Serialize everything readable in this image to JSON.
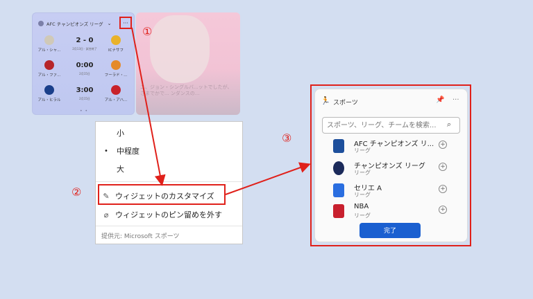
{
  "widget": {
    "title": "AFC チャンピオンズ リーグ",
    "chevron": "chevron-down",
    "more_label": "···",
    "pager": "• •",
    "matches": [
      {
        "home": "アル・シャ...",
        "away": "ICナサフ",
        "score": "2 - 0",
        "sub": "2月13日 · 試合終了",
        "home_color": "#d0c9b8",
        "away_color": "#e9b22a"
      },
      {
        "home": "アル・ファ...",
        "away": "フーラド・...",
        "score": "0:00",
        "sub": "2月15日",
        "home_color": "#b6252a",
        "away_color": "#e58a2a"
      },
      {
        "home": "アル・ヒラル",
        "away": "アル・アハ...",
        "score": "3:00",
        "sub": "2月15日",
        "home_color": "#1a3f8a",
        "away_color": "#c8222a"
      }
    ]
  },
  "news": {
    "text": "ニ、ジョン・シングルバ...ットでしたが、さまでかで... ンダンスの..."
  },
  "annotations": {
    "one": "①",
    "two": "②",
    "three": "③",
    "color": "#e0201a"
  },
  "menu": {
    "items": [
      {
        "label": "小",
        "selected": false
      },
      {
        "label": "中程度",
        "selected": true
      },
      {
        "label": "大",
        "selected": false
      }
    ],
    "customize": "ウィジェットのカスタマイズ",
    "unpin": "ウィジェットのピン留めを外す",
    "provider": "提供元: Microsoft スポーツ",
    "bullet": "•"
  },
  "sports": {
    "title": "スポーツ",
    "search_placeholder": "スポーツ、リーグ、チームを検索...",
    "leagues": [
      {
        "name": "AFC チャンピオンズ リ...",
        "kind": "リーグ",
        "color": "#1d4f9c"
      },
      {
        "name": "チャンピオンズ リーグ",
        "kind": "リーグ",
        "color": "#1b2a5a"
      },
      {
        "name": "セリエ A",
        "kind": "リーグ",
        "color": "#2a6ee0"
      },
      {
        "name": "NBA",
        "kind": "リーグ",
        "color": "#c8202e"
      }
    ],
    "add_symbol": "+",
    "done_label": "完了",
    "accent": "#1a5fd0"
  }
}
